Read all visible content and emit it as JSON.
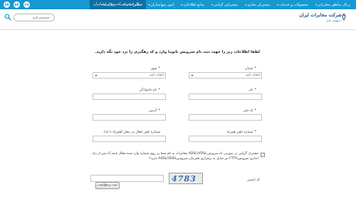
{
  "topnav": {
    "old_portal": "پرتال قدیم شرکت مخابرات ایران",
    "lang_en": "EN",
    "lang_ar": "AR",
    "lang_ch": "CH",
    "items": [
      "پرتال مناطق مخابراتی",
      "محصولات و خدمات",
      "مشتریان تجاری",
      "مشترکین گرامی",
      "منابع اطلاعاتی",
      "امور سهامداران",
      "تماس با ما",
      "درباره ما"
    ]
  },
  "header": {
    "search_placeholder": "جستجو کنید",
    "logo_text": "شرکت مخابرات ایران",
    "logo_sub": "(سهامی عام)"
  },
  "form": {
    "intro": "لطفا اطلاعات زیر را جهت ثبت نام سرویس تانوما وارد و کد رهگیری را نزد خود نگه دارید.",
    "province_label": "استان",
    "province_value": "انتخاب کنید",
    "city_label": "شهر",
    "city_value": "انتخاب کنید",
    "name_label": "نام",
    "family_label": "نام خانوادگی",
    "national_code_label": "کد ملی",
    "address_label": "آدرس",
    "mobile_label": "شماره تلفن همراه",
    "landline_label": "شماره تلفن فعال در محل (همراه با کد)",
    "consent_text": "مشترک گرامی در صورتی که سرویسADSL/VDSL مخابرات به نام شما بر روی شماره وارد شده فعال باشد آیا پس از راه اندازی سرویسFTTH نیز تمایل به برقراری همزمان سرویسADSL/VDSL دارید؟",
    "captcha_label": "کد امنیتی",
    "captcha_text": "4783",
    "submit_label": "ثبت درخواست"
  },
  "colors": {
    "topbar": "#1798d0",
    "required": "#dd0000"
  }
}
